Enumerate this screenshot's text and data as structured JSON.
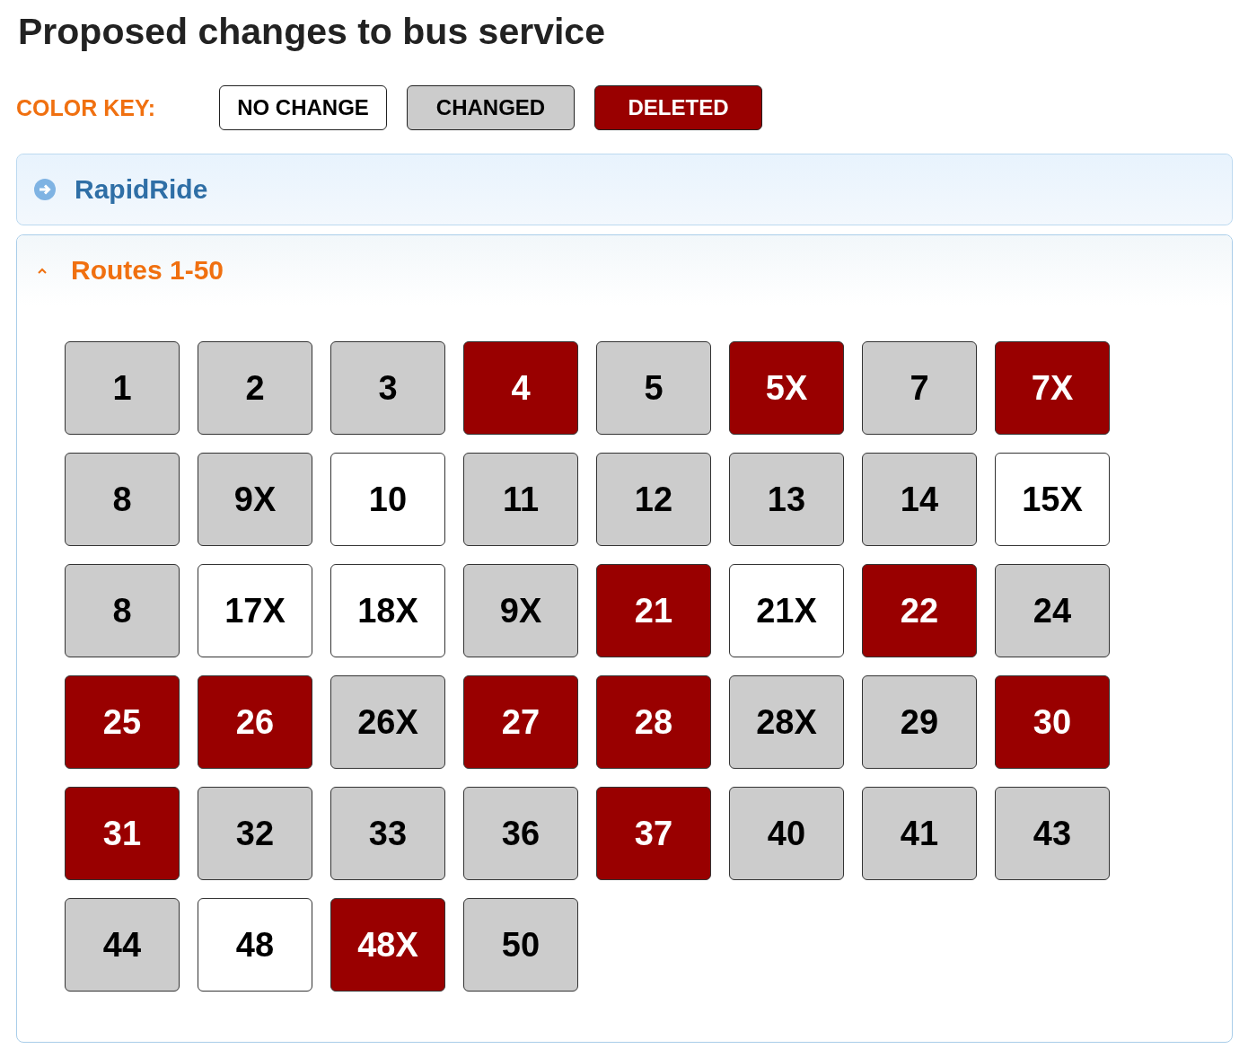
{
  "title": "Proposed changes to bus service",
  "color_key": {
    "label": "COLOR KEY:",
    "items": [
      {
        "label": "NO CHANGE",
        "color": "#ffffff"
      },
      {
        "label": "CHANGED",
        "color": "#cccccc"
      },
      {
        "label": "DELETED",
        "color": "#990000"
      }
    ]
  },
  "panels": [
    {
      "title": "RapidRide",
      "expanded": false
    },
    {
      "title": "Routes 1-50",
      "expanded": true,
      "routes": [
        {
          "label": "1",
          "color": "#cccccc"
        },
        {
          "label": "2",
          "color": "#cccccc"
        },
        {
          "label": "3",
          "color": "#cccccc"
        },
        {
          "label": "4",
          "color": "#990000"
        },
        {
          "label": "5",
          "color": "#cccccc"
        },
        {
          "label": "5X",
          "color": "#990000"
        },
        {
          "label": "7",
          "color": "#cccccc"
        },
        {
          "label": "7X",
          "color": "#990000"
        },
        {
          "label": "8",
          "color": "#cccccc"
        },
        {
          "label": "9X",
          "color": "#cccccc"
        },
        {
          "label": "10",
          "color": "#ffffff"
        },
        {
          "label": "11",
          "color": "#cccccc"
        },
        {
          "label": "12",
          "color": "#cccccc"
        },
        {
          "label": "13",
          "color": "#cccccc"
        },
        {
          "label": "14",
          "color": "#cccccc"
        },
        {
          "label": "15X",
          "color": "#ffffff"
        },
        {
          "label": "8",
          "color": "#cccccc"
        },
        {
          "label": "17X",
          "color": "#ffffff"
        },
        {
          "label": "18X",
          "color": "#ffffff"
        },
        {
          "label": "9X",
          "color": "#cccccc"
        },
        {
          "label": "21",
          "color": "#990000"
        },
        {
          "label": "21X",
          "color": "#ffffff"
        },
        {
          "label": "22",
          "color": "#990000"
        },
        {
          "label": "24",
          "color": "#cccccc"
        },
        {
          "label": "25",
          "color": "#990000"
        },
        {
          "label": "26",
          "color": "#990000"
        },
        {
          "label": "26X",
          "color": "#cccccc"
        },
        {
          "label": "27",
          "color": "#990000"
        },
        {
          "label": "28",
          "color": "#990000"
        },
        {
          "label": "28X",
          "color": "#cccccc"
        },
        {
          "label": "29",
          "color": "#cccccc"
        },
        {
          "label": "30",
          "color": "#990000"
        },
        {
          "label": "31",
          "color": "#990000"
        },
        {
          "label": "32",
          "color": "#cccccc"
        },
        {
          "label": "33",
          "color": "#cccccc"
        },
        {
          "label": "36",
          "color": "#cccccc"
        },
        {
          "label": "37",
          "color": "#990000"
        },
        {
          "label": "40",
          "color": "#cccccc"
        },
        {
          "label": "41",
          "color": "#cccccc"
        },
        {
          "label": "43",
          "color": "#cccccc"
        },
        {
          "label": "44",
          "color": "#cccccc"
        },
        {
          "label": "48",
          "color": "#ffffff"
        },
        {
          "label": "48X",
          "color": "#990000"
        },
        {
          "label": "50",
          "color": "#cccccc"
        }
      ]
    }
  ]
}
